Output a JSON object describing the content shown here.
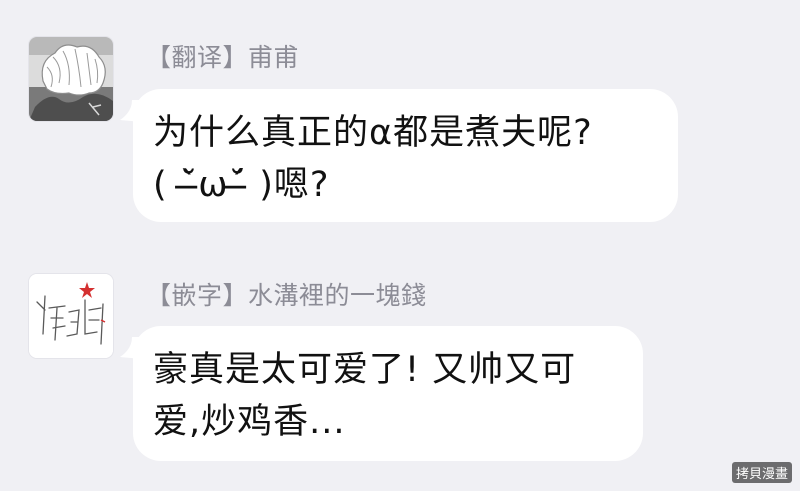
{
  "messages": [
    {
      "sender": "【翻译】甫甫",
      "text": "为什么真正的α都是煮夫呢?\n( ˘̶̀ω˘̶́ )嗯?",
      "avatar_icon": "manga-white-hair-character-avatar"
    },
    {
      "sender": "【嵌字】水溝裡的一塊錢",
      "text": "豪真是太可爱了! 又帅又可\n爱,炒鸡香...",
      "avatar_icon": "handwritten-logo-avatar"
    }
  ],
  "watermark": "拷貝漫畫",
  "colors": {
    "background": "#f0f0f4",
    "bubble": "#ffffff",
    "sender_text": "#8c8c96",
    "message_text": "#111111"
  }
}
